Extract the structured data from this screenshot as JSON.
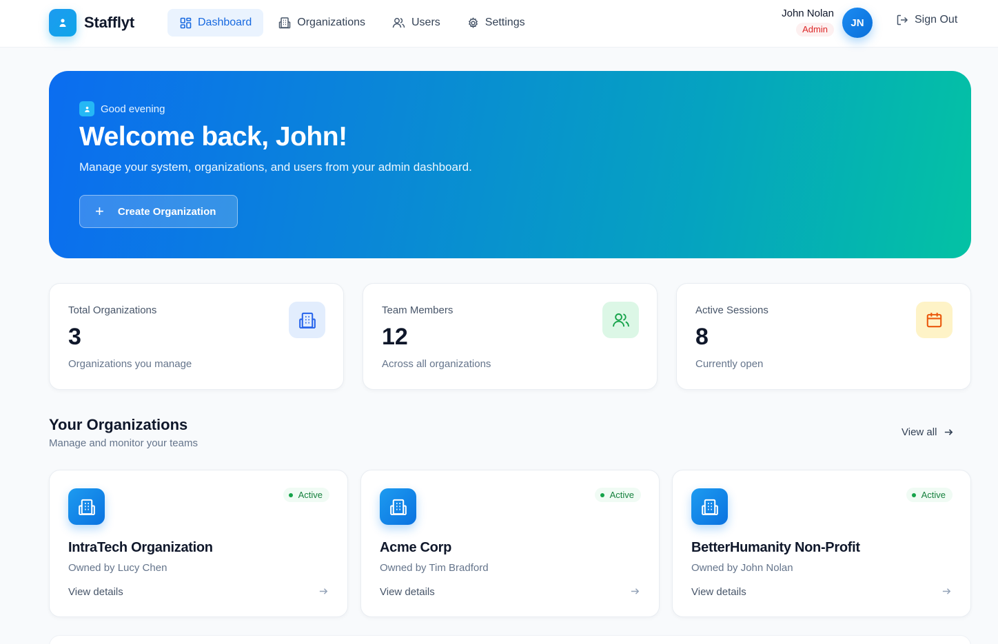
{
  "header": {
    "brand": "Stafflyt",
    "nav": [
      {
        "label": "Dashboard",
        "icon": "dashboard-icon",
        "active": true
      },
      {
        "label": "Organizations",
        "icon": "building-icon"
      },
      {
        "label": "Users",
        "icon": "users-icon"
      },
      {
        "label": "Settings",
        "icon": "gear-icon"
      }
    ],
    "user": {
      "name": "John Nolan",
      "role": "Admin",
      "initials": "JN"
    },
    "sign_out": "Sign Out"
  },
  "hero": {
    "greeting": "Good evening",
    "title": "Welcome back, John!",
    "subtitle": "Manage your system, organizations, and users from your admin dashboard.",
    "cta": "Create Organization"
  },
  "stats": [
    {
      "label": "Total Organizations",
      "value": "3",
      "note": "Organizations you manage",
      "icon": "building-icon",
      "color": "#2563eb"
    },
    {
      "label": "Team Members",
      "value": "12",
      "note": "Across all organizations",
      "icon": "users-icon",
      "color": "#16a34a"
    },
    {
      "label": "Active Sessions",
      "value": "8",
      "note": "Currently open",
      "icon": "calendar-icon",
      "color": "#ea580c"
    }
  ],
  "orgs_section": {
    "title": "Your Organizations",
    "subtitle": "Manage and monitor your teams",
    "view_all": "View all"
  },
  "organizations": [
    {
      "name": "IntraTech Organization",
      "owner": "Owned by Lucy Chen",
      "status": "Active",
      "link": "View details"
    },
    {
      "name": "Acme Corp",
      "owner": "Owned by Tim Bradford",
      "status": "Active",
      "link": "View details"
    },
    {
      "name": "BetterHumanity Non-Profit",
      "owner": "Owned by John Nolan",
      "status": "Active",
      "link": "View details"
    }
  ],
  "colors": {
    "accent": "#1769e0",
    "hero_start": "#0b6df0",
    "hero_end": "#04c2a4",
    "active_green": "#16a34a"
  }
}
